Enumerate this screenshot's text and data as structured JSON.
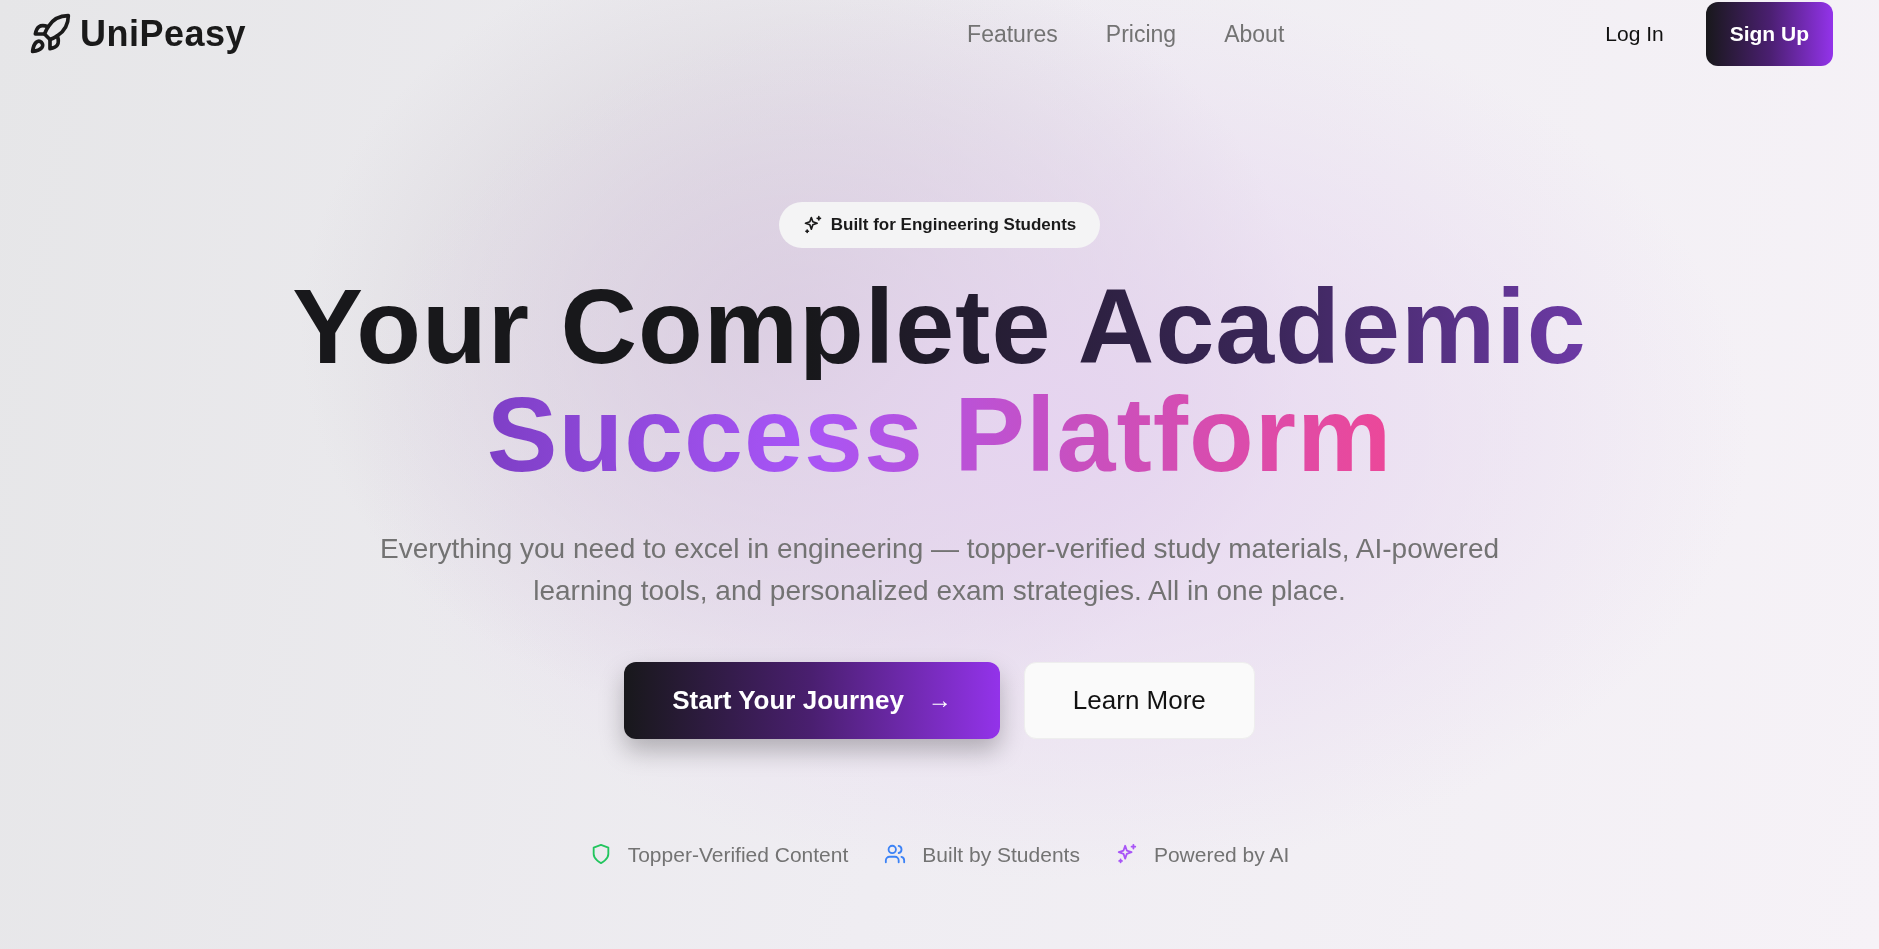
{
  "brand": {
    "name": "UniPeasy"
  },
  "nav_links": [
    "Features",
    "Pricing",
    "About"
  ],
  "auth": {
    "login": "Log In",
    "signup": "Sign Up"
  },
  "hero": {
    "badge": "Built for Engineering Students",
    "heading_lines": [
      "Your Complete Academic",
      "Success Platform"
    ],
    "subtitle": "Everything you need to excel in engineering — topper-verified study materials, AI-powered learning tools, and personalized exam strategies. All in one place.",
    "primary_button": {
      "label": "Start Your Journey",
      "arrow": "→"
    },
    "secondary_button": {
      "label": "Learn More"
    }
  },
  "features": [
    {
      "kind": "shield",
      "color": "#22c55e",
      "label": "Topper-Verified Content"
    },
    {
      "kind": "users",
      "color": "#3b82f6",
      "label": "Built by Students"
    },
    {
      "kind": "sparkles",
      "color": "#a855f7",
      "label": "Powered by AI"
    }
  ]
}
